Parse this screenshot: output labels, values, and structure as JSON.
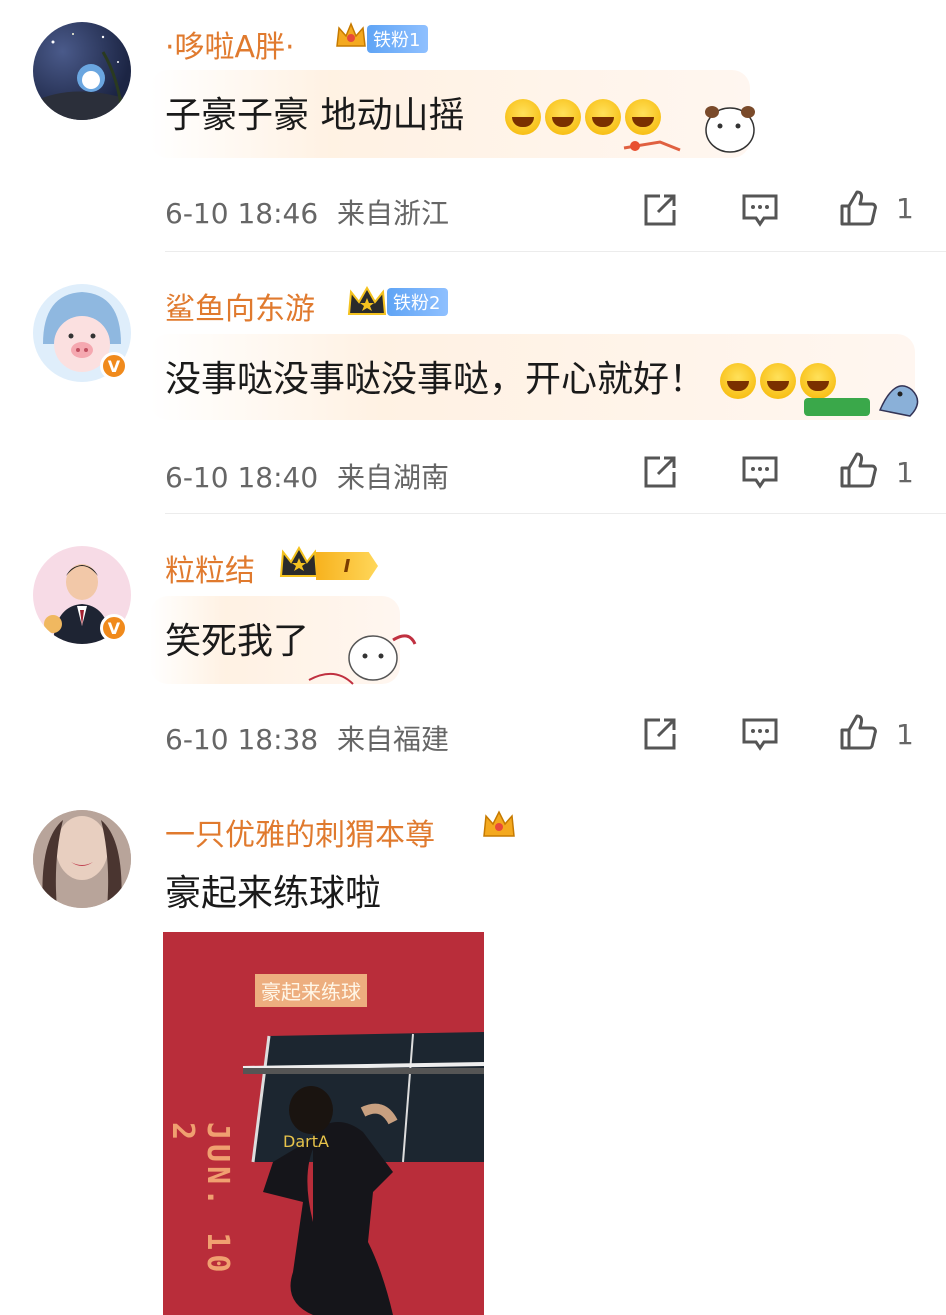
{
  "comments": [
    {
      "username": "·哆啦A胖·",
      "fan_badge": "铁粉1",
      "text": "子豪子豪 地动山摇",
      "time": "6-10 18:46",
      "location": "来自浙江",
      "likes": "1"
    },
    {
      "username": "鲨鱼向东游",
      "fan_badge": "铁粉2",
      "text": "没事哒没事哒没事哒，开心就好！",
      "time": "6-10 18:40",
      "location": "来自湖南",
      "likes": "1"
    },
    {
      "username": "粒粒结",
      "level_badge": "I",
      "text": "笑死我了",
      "time": "6-10 18:38",
      "location": "来自福建",
      "likes": "1"
    },
    {
      "username": "一只优雅的刺猬本尊",
      "text": "豪起来练球啦",
      "video_caption": "豪起来练球",
      "video_date": "JUN. 10 2"
    }
  ],
  "colors": {
    "username": "#e07a2e",
    "meta": "#666666",
    "verified": "#f08a1c",
    "fan_badge": "#5fa4f5"
  },
  "icons": [
    "crown-icon",
    "repost-icon",
    "comment-icon",
    "like-icon",
    "verified-icon",
    "laughing-emoji"
  ]
}
